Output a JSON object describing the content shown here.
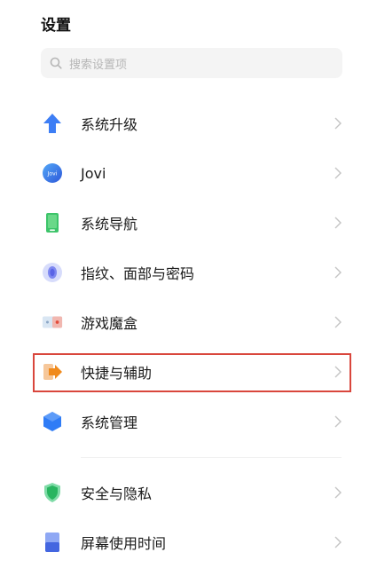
{
  "header": {
    "title": "设置"
  },
  "search": {
    "placeholder": "搜索设置项"
  },
  "items": [
    {
      "label": "系统升级",
      "icon": "upgrade-arrow-icon"
    },
    {
      "label": "Jovi",
      "icon": "jovi-icon"
    },
    {
      "label": "系统导航",
      "icon": "navigation-phone-icon"
    },
    {
      "label": "指纹、面部与密码",
      "icon": "fingerprint-icon"
    },
    {
      "label": "游戏魔盒",
      "icon": "game-box-icon"
    },
    {
      "label": "快捷与辅助",
      "icon": "shortcut-arrow-icon"
    },
    {
      "label": "系统管理",
      "icon": "system-hexagon-icon"
    },
    {
      "label": "安全与隐私",
      "icon": "security-shield-icon"
    },
    {
      "label": "屏幕使用时间",
      "icon": "screen-time-icon"
    }
  ],
  "colors": {
    "highlight": "#d9463c",
    "accent": "#2f7cf6"
  }
}
